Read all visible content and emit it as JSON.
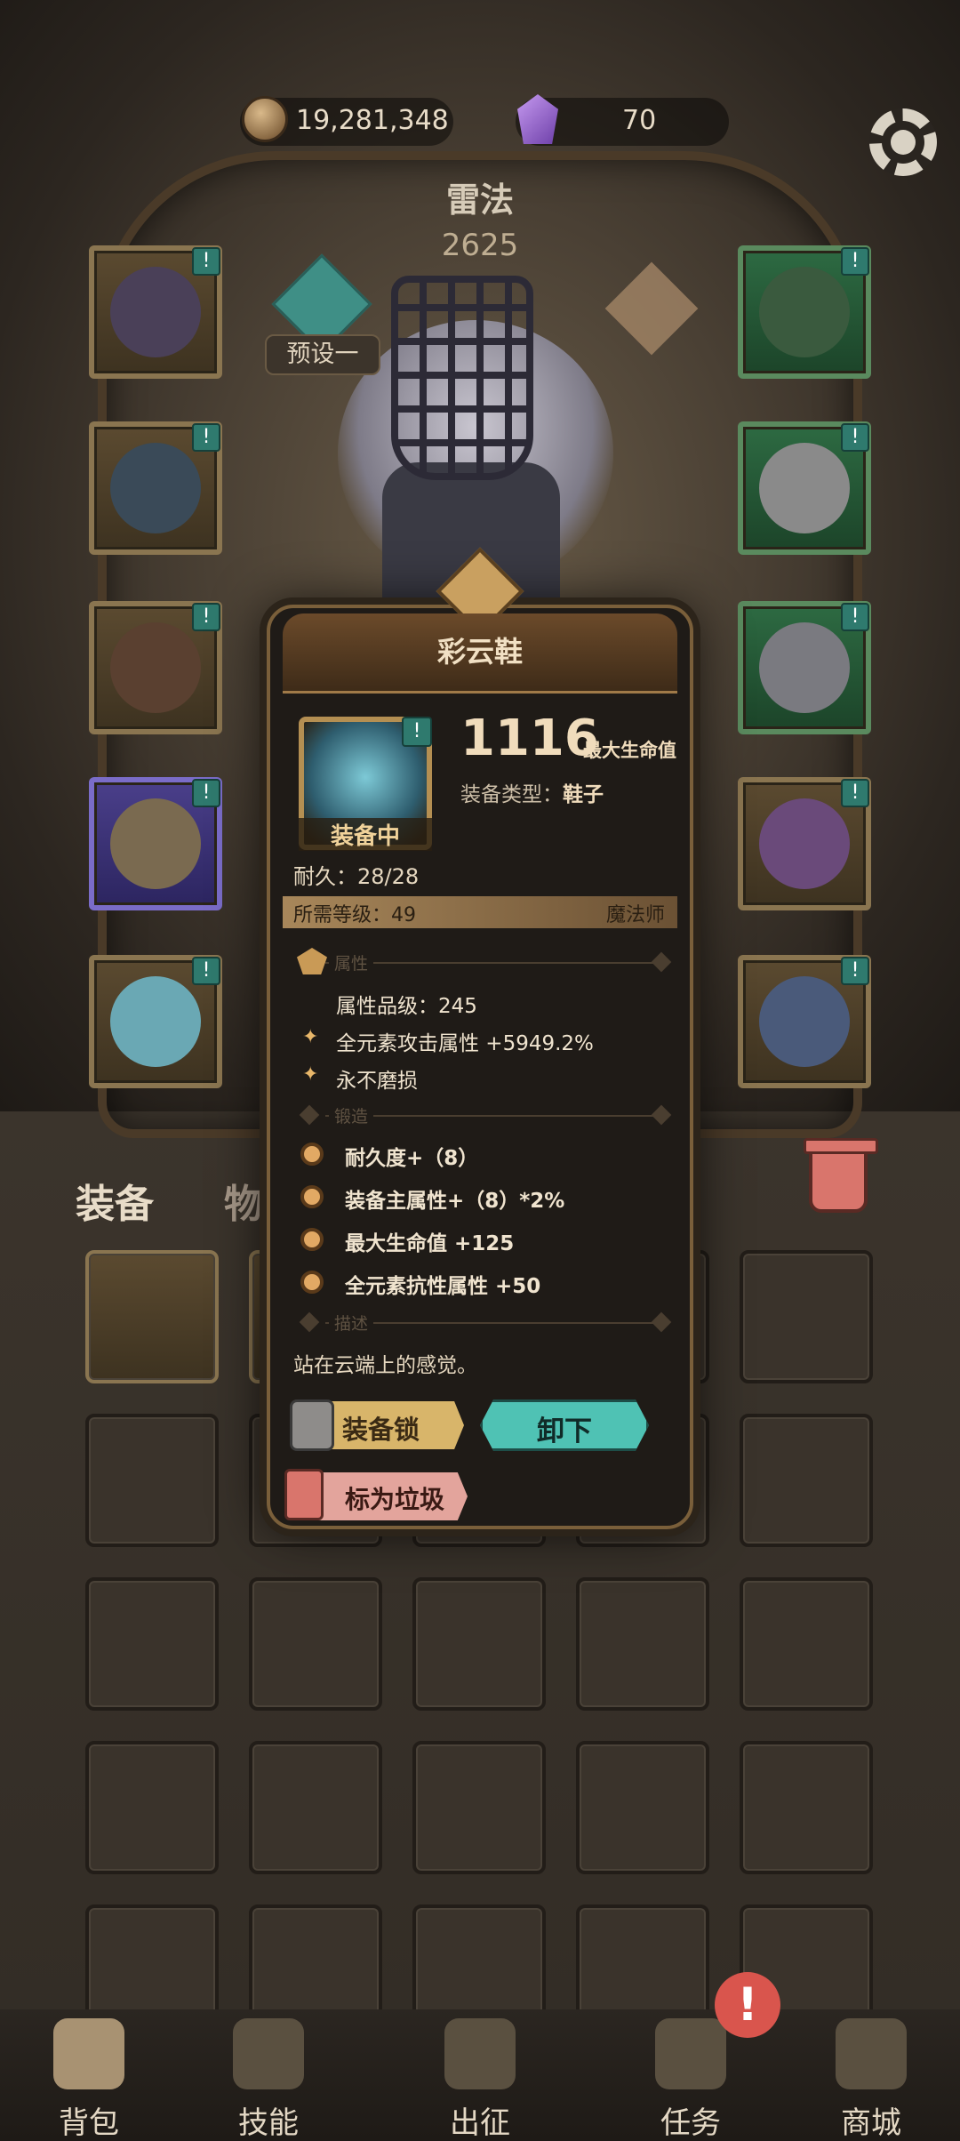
{
  "resources": {
    "gold": "19,281,348",
    "gems": "70"
  },
  "character": {
    "name": "雷法",
    "power": "2625",
    "preset_label": "预设一"
  },
  "slot_badge": "!",
  "tabs": {
    "equipment": "装备",
    "items": "物品"
  },
  "item_detail": {
    "name": "彩云鞋",
    "main_stat_value": "1116",
    "main_stat_label": "最大生命值",
    "type_label": "装备类型：",
    "type_value": "鞋子",
    "equipped_label": "装备中",
    "durability": "耐久：28/28",
    "required_level": "所需等级：49",
    "required_class": "魔法师",
    "section_attributes": "属性",
    "attributes": [
      "属性品级：245",
      "全元素攻击属性 +5949.2%",
      "永不磨损"
    ],
    "section_forging": "锻造",
    "forging": [
      "耐久度+（8）",
      "装备主属性+（8）*2%",
      "最大生命值 +125",
      "全元素抗性属性 +50"
    ],
    "section_description": "描述",
    "description": "站在云端上的感觉。",
    "buttons": {
      "lock": "装备锁",
      "unequip": "卸下",
      "mark_trash": "标为垃圾"
    }
  },
  "nav": {
    "items": [
      {
        "label": "背包"
      },
      {
        "label": "技能"
      },
      {
        "label": "出征"
      },
      {
        "label": "任务"
      },
      {
        "label": "商城"
      }
    ],
    "alert": "!"
  },
  "colors": {
    "accent_teal": "#4fc2b4",
    "gold": "#d8b56a",
    "danger": "#d9554d"
  }
}
